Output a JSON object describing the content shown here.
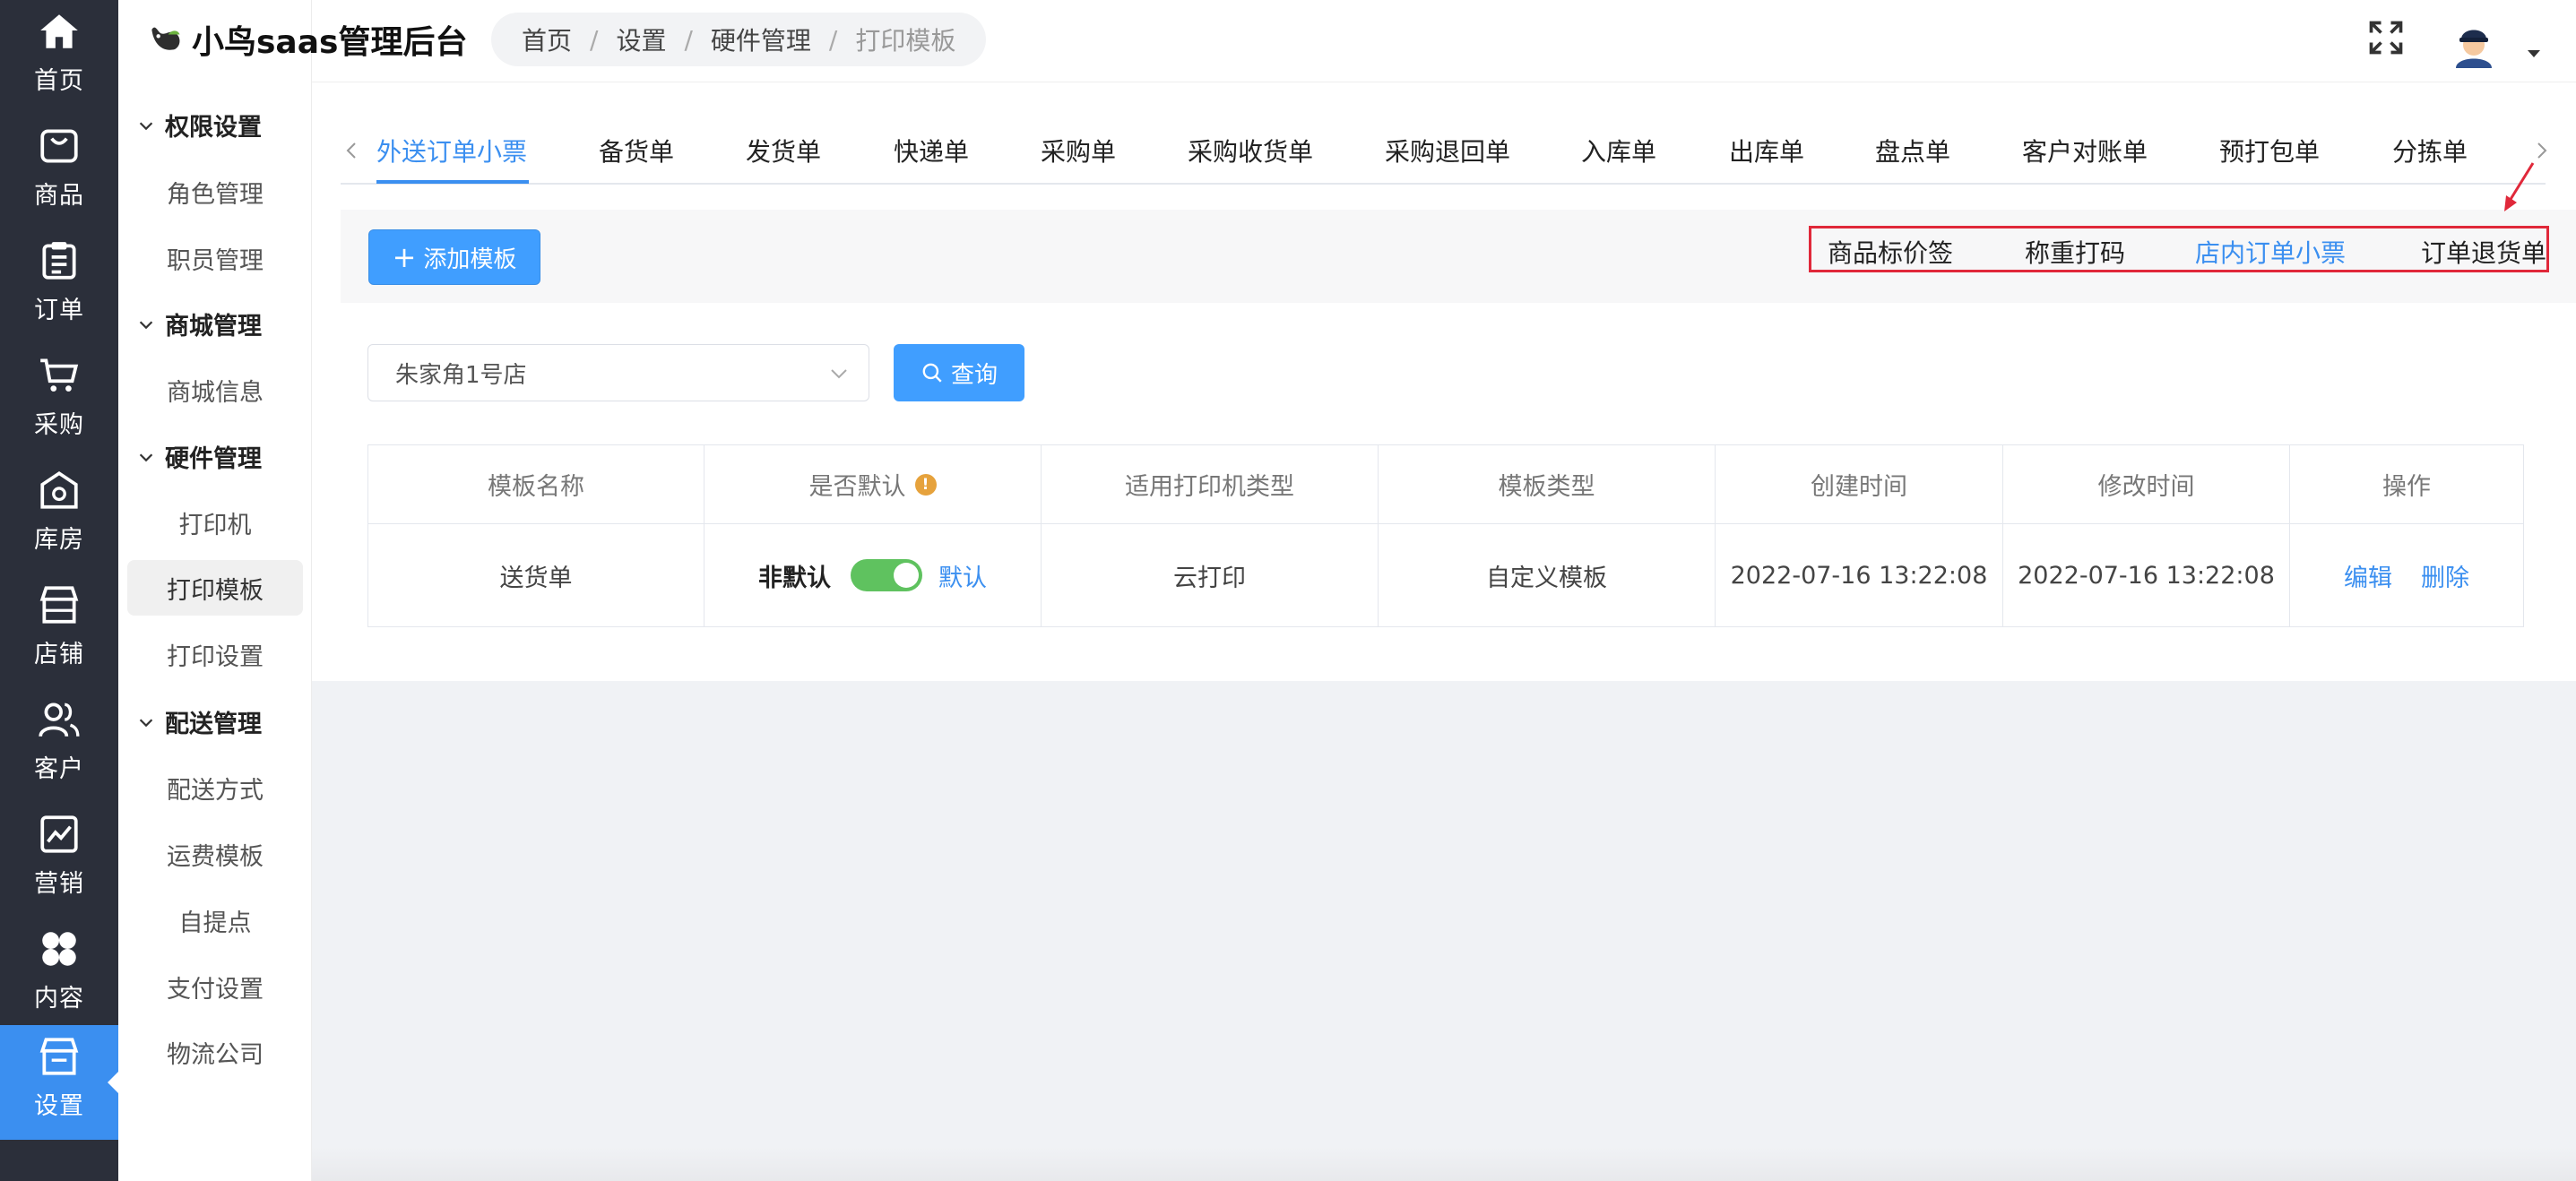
{
  "rail": {
    "items": [
      {
        "label": "首页",
        "icon": "home-icon"
      },
      {
        "label": "商品",
        "icon": "bag-icon"
      },
      {
        "label": "订单",
        "icon": "clipboard-icon"
      },
      {
        "label": "采购",
        "icon": "cart-icon"
      },
      {
        "label": "库房",
        "icon": "warehouse-icon"
      },
      {
        "label": "店铺",
        "icon": "store-icon"
      },
      {
        "label": "客户",
        "icon": "users-icon"
      },
      {
        "label": "营销",
        "icon": "chart-icon"
      },
      {
        "label": "内容",
        "icon": "clover-icon"
      },
      {
        "label": "设置",
        "icon": "settings-store-icon"
      }
    ],
    "active_index": 9
  },
  "sidebar": {
    "groups": [
      {
        "title": "权限设置",
        "items": [
          "角色管理",
          "职员管理"
        ]
      },
      {
        "title": "商城管理",
        "items": [
          "商城信息"
        ]
      },
      {
        "title": "硬件管理",
        "items": [
          "打印机",
          "打印模板",
          "打印设置"
        ]
      },
      {
        "title": "配送管理",
        "items": [
          "配送方式",
          "运费模板",
          "自提点",
          "支付设置",
          "物流公司"
        ]
      }
    ],
    "active_item": "打印模板"
  },
  "header": {
    "app_title": "小鸟saas管理后台",
    "breadcrumb": [
      "首页",
      "设置",
      "硬件管理",
      "打印模板"
    ]
  },
  "tabs": {
    "items": [
      "外送订单小票",
      "备货单",
      "发货单",
      "快递单",
      "采购单",
      "采购收货单",
      "采购退回单",
      "入库单",
      "出库单",
      "盘点单",
      "客户对账单",
      "预打包单",
      "分拣单"
    ],
    "active": "外送订单小票",
    "overflow": [
      "商品标价签",
      "称重打码",
      "店内订单小票",
      "订单退货单"
    ],
    "overflow_active": "店内订单小票"
  },
  "toolbar": {
    "add_label": "添加模板",
    "store_value": "朱家角1号店",
    "query_label": "查询"
  },
  "table": {
    "headers": [
      "模板名称",
      "是否默认",
      "适用打印机类型",
      "模板类型",
      "创建时间",
      "修改时间",
      "操作"
    ],
    "rows": [
      {
        "name": "送货单",
        "default_off_label": "非默认",
        "default_on_label": "默认",
        "default_enabled": true,
        "printer_type": "云打印",
        "template_type": "自定义模板",
        "created": "2022-07-16 13:22:08",
        "modified": "2022-07-16 13:22:08",
        "edit_label": "编辑",
        "delete_label": "删除"
      }
    ]
  },
  "colors": {
    "accent": "#409eff",
    "rail_bg": "#2b2f3a",
    "switch_on": "#5fc25f",
    "highlight_box": "#e0283a",
    "warn": "#e6a23c"
  }
}
